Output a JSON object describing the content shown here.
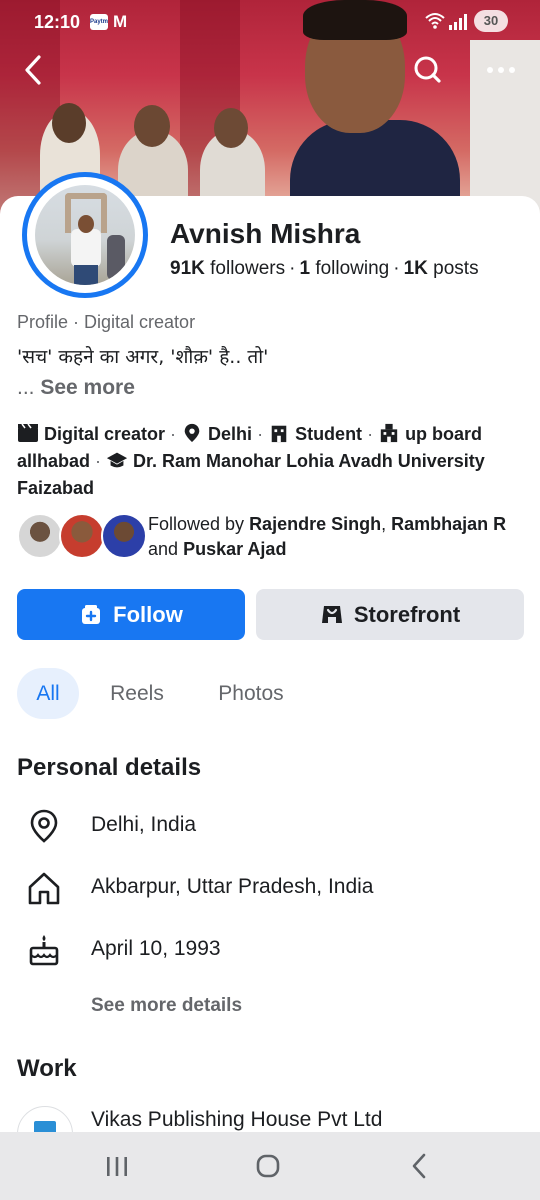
{
  "status_bar": {
    "time": "12:10",
    "app_icon_1": "Paytm",
    "app_icon_2": "M",
    "battery": "30"
  },
  "icons": {
    "back": "chevron-left-icon",
    "search": "search-icon",
    "more": "more-horizontal-icon"
  },
  "profile": {
    "name": "Avnish Mishra",
    "followers_count": "91K",
    "followers_label": "followers",
    "following_count": "1",
    "following_label": "following",
    "posts_count": "1K",
    "posts_label": "posts",
    "category": "Profile · Digital creator",
    "bio": "'सच' कहने का अगर, 'शौक़' है.. तो'",
    "see_more_prefix": "...",
    "see_more": "See more"
  },
  "tags": {
    "creator": "Digital creator",
    "city": "Delhi",
    "student": "Student",
    "college_line": "up board allhabad",
    "university": "Dr. Ram Manohar Lohia Avadh University Faizabad"
  },
  "followed_by": {
    "prefix": "Followed by",
    "name1": "Rajendre Singh",
    "comma": ",",
    "name2": "Rambhajan R",
    "and": "and",
    "name3": "Puskar Ajad"
  },
  "actions": {
    "follow": "Follow",
    "storefront": "Storefront"
  },
  "tabs": [
    "All",
    "Reels",
    "Photos"
  ],
  "personal_details": {
    "title": "Personal details",
    "location": "Delhi, India",
    "hometown": "Akbarpur, Uttar Pradesh, India",
    "birthday": "April 10, 1993",
    "see_more": "See more details"
  },
  "work": {
    "title": "Work",
    "company": "Vikas Publishing House Pvt Ltd"
  },
  "colors": {
    "accent": "#1877f2",
    "secondary_button": "#e4e6eb",
    "muted_text": "#65676b"
  }
}
